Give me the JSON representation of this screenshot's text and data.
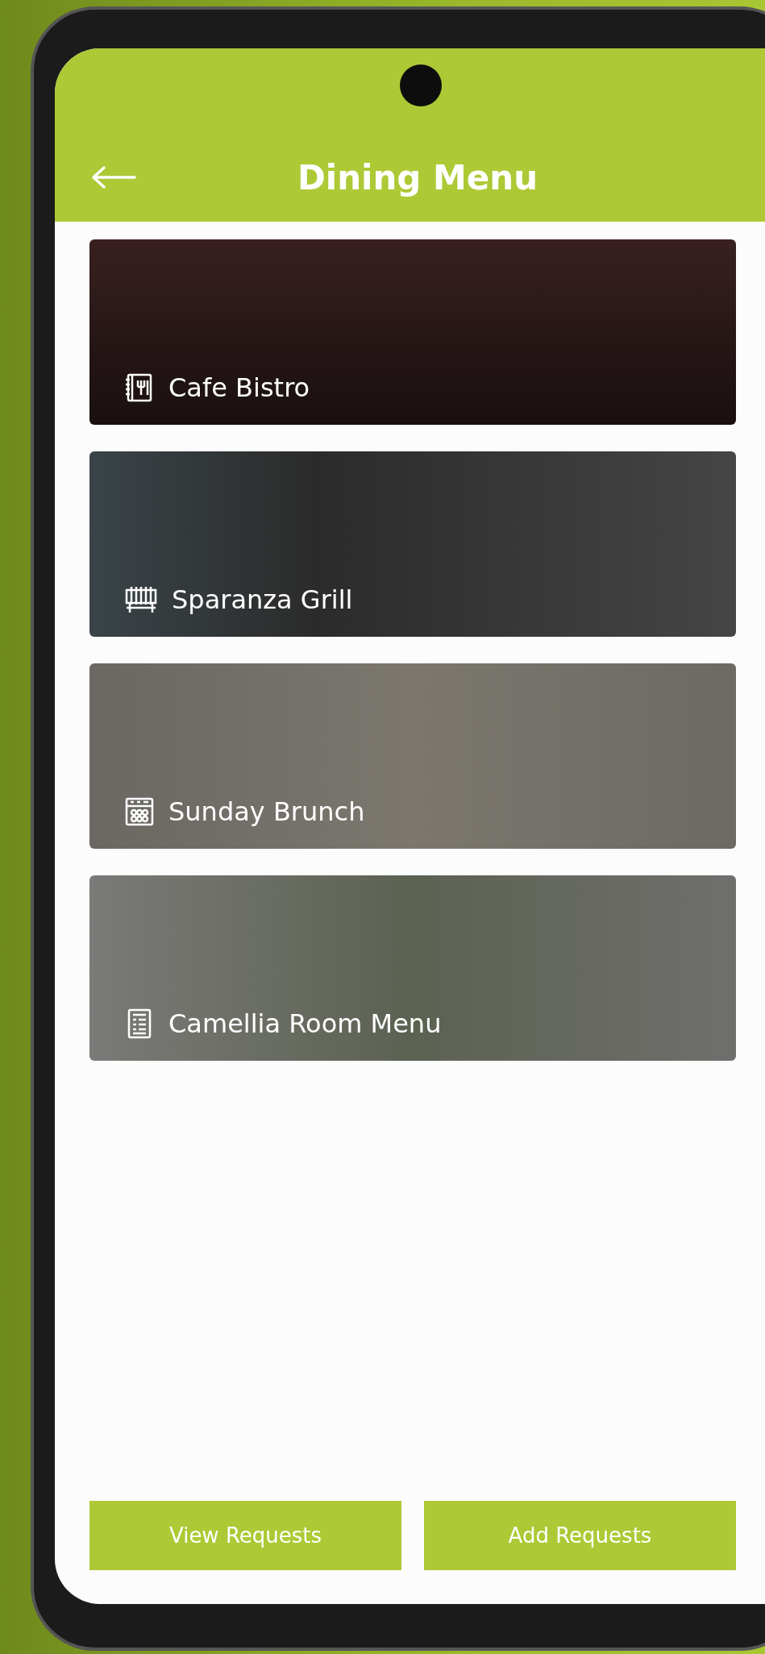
{
  "header": {
    "title": "Dining Menu"
  },
  "menus": [
    {
      "title": "Cafe Bistro",
      "kind": "booklet"
    },
    {
      "title": "Sparanza Grill",
      "kind": "grill"
    },
    {
      "title": "Sunday Brunch",
      "kind": "oven"
    },
    {
      "title": "Camellia Room Menu",
      "kind": "list"
    }
  ],
  "buttons": [
    "View Requests",
    "Add Requests"
  ]
}
